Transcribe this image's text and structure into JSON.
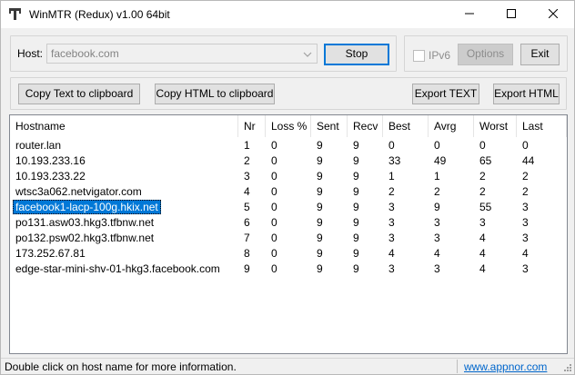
{
  "window": {
    "title": "WinMTR (Redux) v1.00 64bit",
    "icon": "winmtr-app-icon"
  },
  "controls": {
    "host_label": "Host:",
    "host_value": "facebook.com",
    "stop_label": "Stop",
    "ipv6_label": "IPv6",
    "ipv6_checked": false,
    "options_label": "Options",
    "exit_label": "Exit",
    "copy_text_label": "Copy Text to clipboard",
    "copy_html_label": "Copy HTML to clipboard",
    "export_text_label": "Export TEXT",
    "export_html_label": "Export HTML"
  },
  "table": {
    "columns": [
      "Hostname",
      "Nr",
      "Loss %",
      "Sent",
      "Recv",
      "Best",
      "Avrg",
      "Worst",
      "Last"
    ],
    "selected_row": 4,
    "selection_color": "#0078d7",
    "rows": [
      [
        "router.lan",
        "1",
        "0",
        "9",
        "9",
        "0",
        "0",
        "0",
        "0"
      ],
      [
        "10.193.233.16",
        "2",
        "0",
        "9",
        "9",
        "33",
        "49",
        "65",
        "44"
      ],
      [
        "10.193.233.22",
        "3",
        "0",
        "9",
        "9",
        "1",
        "1",
        "2",
        "2"
      ],
      [
        "wtsc3a062.netvigator.com",
        "4",
        "0",
        "9",
        "9",
        "2",
        "2",
        "2",
        "2"
      ],
      [
        "facebook1-lacp-100g.hkix.net",
        "5",
        "0",
        "9",
        "9",
        "3",
        "9",
        "55",
        "3"
      ],
      [
        "po131.asw03.hkg3.tfbnw.net",
        "6",
        "0",
        "9",
        "9",
        "3",
        "3",
        "3",
        "3"
      ],
      [
        "po132.psw02.hkg3.tfbnw.net",
        "7",
        "0",
        "9",
        "9",
        "3",
        "3",
        "4",
        "3"
      ],
      [
        "173.252.67.81",
        "8",
        "0",
        "9",
        "9",
        "4",
        "4",
        "4",
        "4"
      ],
      [
        "edge-star-mini-shv-01-hkg3.facebook.com",
        "9",
        "0",
        "9",
        "9",
        "3",
        "3",
        "4",
        "3"
      ]
    ]
  },
  "statusbar": {
    "message": "Double click on host name for more information.",
    "link": "www.appnor.com",
    "link_color": "#0066cc"
  }
}
